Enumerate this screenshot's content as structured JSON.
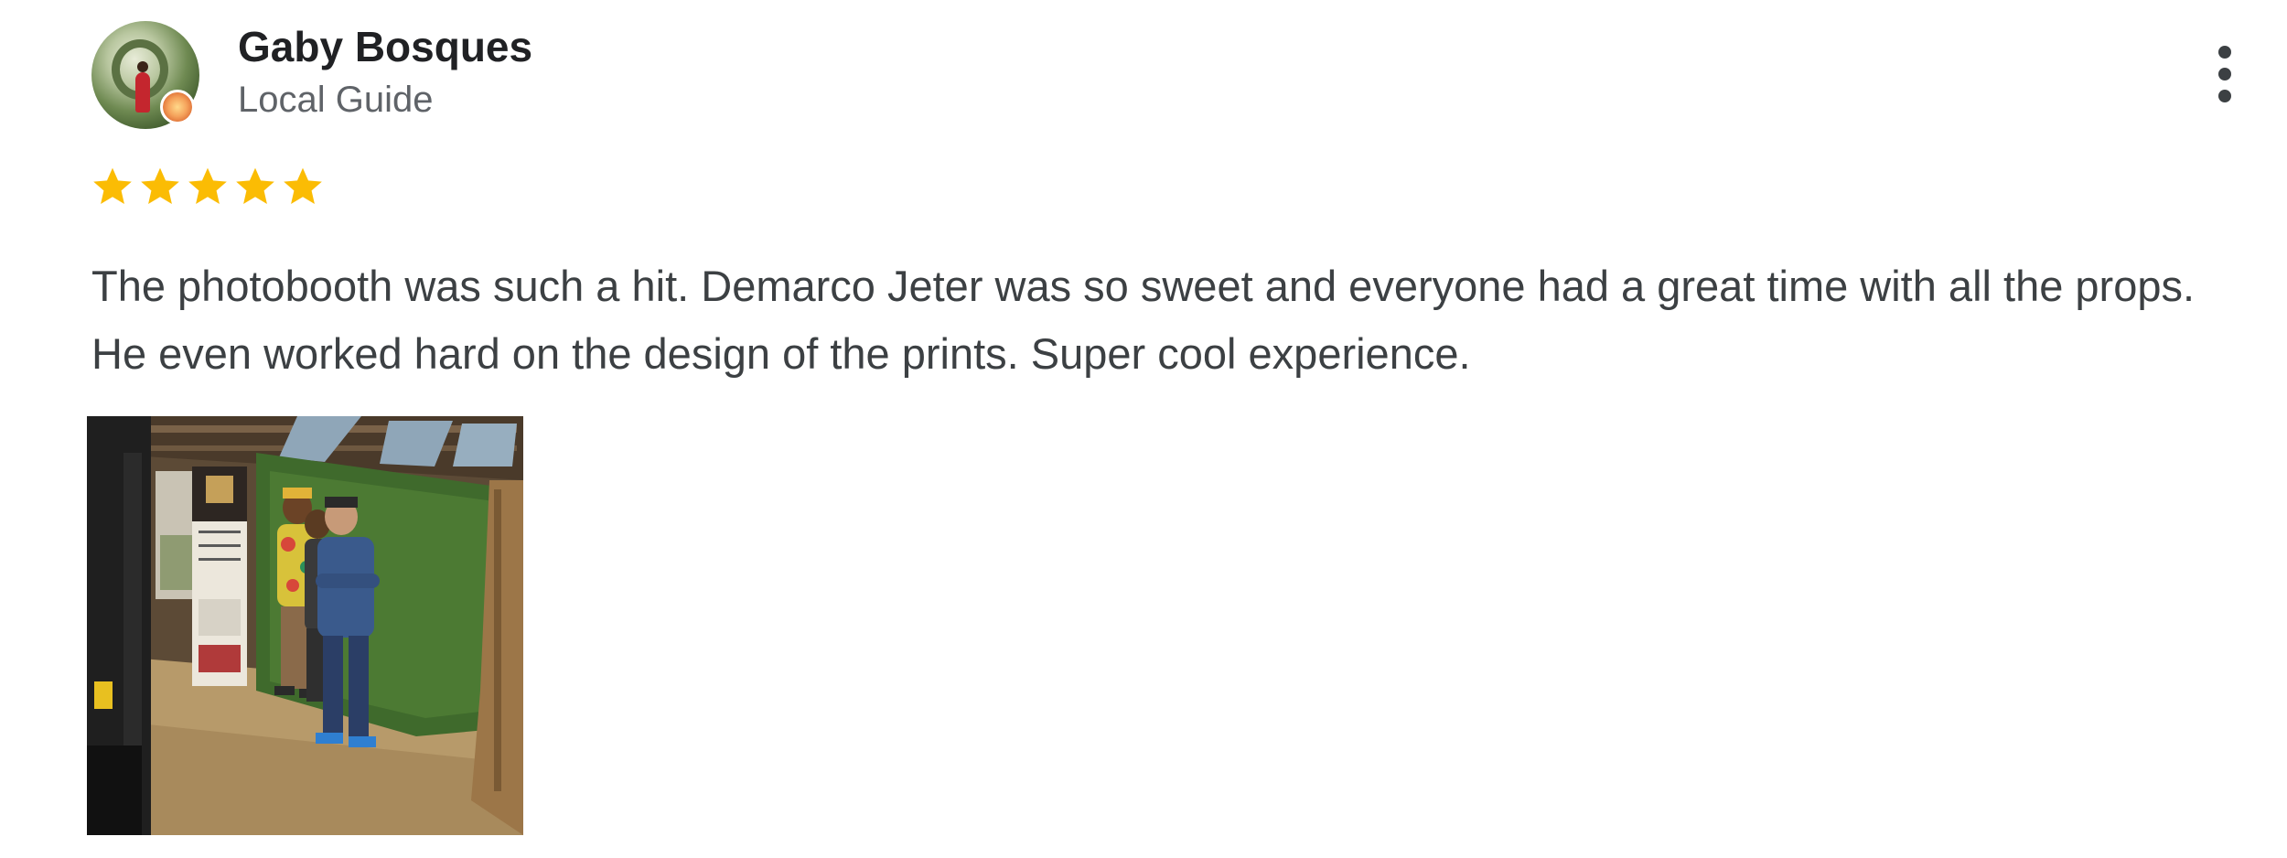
{
  "review": {
    "reviewer_name": "Gaby Bosques",
    "reviewer_subtitle": "Local Guide",
    "rating": 5,
    "rating_max": 5,
    "text": "The photobooth was such a hit. Demarco Jeter was so sweet and everyone had a great time with all the props. He even worked hard on the design of the prints. Super cool experience."
  },
  "icons": {
    "avatar": "avatar-photo",
    "badge": "local-guide-badge-icon",
    "more": "more-vert-icon",
    "star": "star-icon"
  },
  "colors": {
    "star": "#FBBC04",
    "name": "#202124",
    "subtitle": "#5f6368",
    "body_text": "#3c4043"
  }
}
